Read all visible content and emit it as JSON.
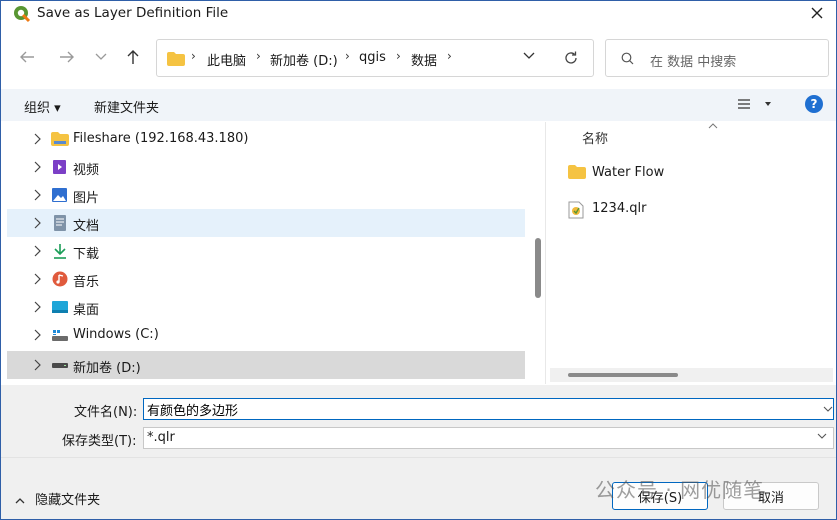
{
  "window": {
    "title": "Save as Layer Definition File"
  },
  "address": {
    "crumbs": [
      "此电脑",
      "新加卷 (D:)",
      "qgis",
      "数据"
    ]
  },
  "search": {
    "placeholder": "在 数据 中搜索"
  },
  "toolbar": {
    "organize": "组织 ▾",
    "new_folder": "新建文件夹",
    "help": "?"
  },
  "nav": {
    "items": [
      {
        "label": "Fileshare (192.168.43.180)",
        "icon": "network-folder-icon"
      },
      {
        "label": "视频",
        "icon": "videos-icon"
      },
      {
        "label": "图片",
        "icon": "pictures-icon"
      },
      {
        "label": "文档",
        "icon": "documents-icon"
      },
      {
        "label": "下载",
        "icon": "downloads-icon"
      },
      {
        "label": "音乐",
        "icon": "music-icon"
      },
      {
        "label": "桌面",
        "icon": "desktop-icon"
      },
      {
        "label": "Windows (C:)",
        "icon": "drive-c-icon"
      },
      {
        "label": "新加卷 (D:)",
        "icon": "drive-d-icon"
      }
    ]
  },
  "content": {
    "column_header": "名称",
    "files": [
      {
        "name": "Water Flow",
        "icon": "folder-icon"
      },
      {
        "name": "1234.qlr",
        "icon": "qlr-file-icon"
      }
    ]
  },
  "form": {
    "filename_label": "文件名(N):",
    "filename_value": "有颜色的多边形",
    "filetype_label": "保存类型(T):",
    "filetype_value": "*.qlr"
  },
  "footer": {
    "hide_folders": "隐藏文件夹",
    "save": "保存(S)",
    "cancel": "取消",
    "watermark": "公众号 · 网优随笔"
  },
  "colors": {
    "accent": "#0067c0",
    "folder": "#f5c342",
    "help": "#1f6fd1",
    "selection": "#e5f1fb"
  }
}
